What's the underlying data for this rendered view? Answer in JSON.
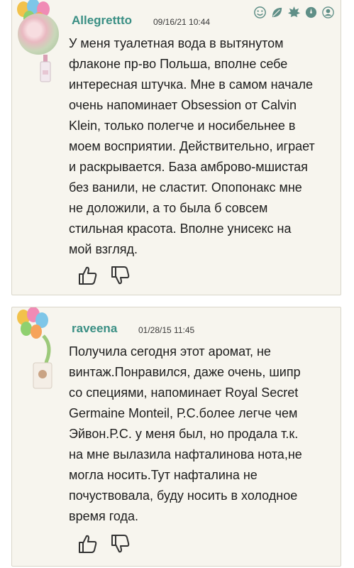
{
  "comments": [
    {
      "username": "Allegrettto",
      "timestamp": "09/16/21 10:44",
      "text_lines": [
        "У меня туалетная вода в вытянутом",
        "флаконе пр-во Польша, вполне себе",
        "интересная штучка. Мне в самом начале",
        "очень напоминает Obsession от Calvin",
        "Klein, только полегче и носибельнее в",
        "моем восприятии. Действительно, играет",
        "и раскрывается. База амброво-мшистая",
        "без ванили, не сластит. Опопонакс мне",
        "не доложили, а то была б совсем",
        "стильная красота. Вполне унисекс на",
        "мой взгляд."
      ],
      "toolbar_icons": [
        "smile-icon",
        "leaf-icon",
        "maple-leaf-icon",
        "settings-icon",
        "user-icon"
      ]
    },
    {
      "username": "raveena",
      "timestamp": "01/28/15 11:45",
      "text_lines": [
        "Получила сегодня этот аромат, не",
        "винтаж.Понравился, даже очень, шипр",
        "со специями, напоминает Royal Secret",
        "Germaine Monteil, Р.С.более легче чем",
        "Эйвон.Р.С. у меня был, но продала т.к.",
        "на мне вылазила нафталинова нота,не",
        "могла носить.Тут нафталина не",
        "почуствовала, буду носить в холодное",
        "время года."
      ]
    }
  ],
  "colors": {
    "username": "#3a8f84",
    "card_bg": "#f7f5ee",
    "icon": "#5f8f87"
  }
}
